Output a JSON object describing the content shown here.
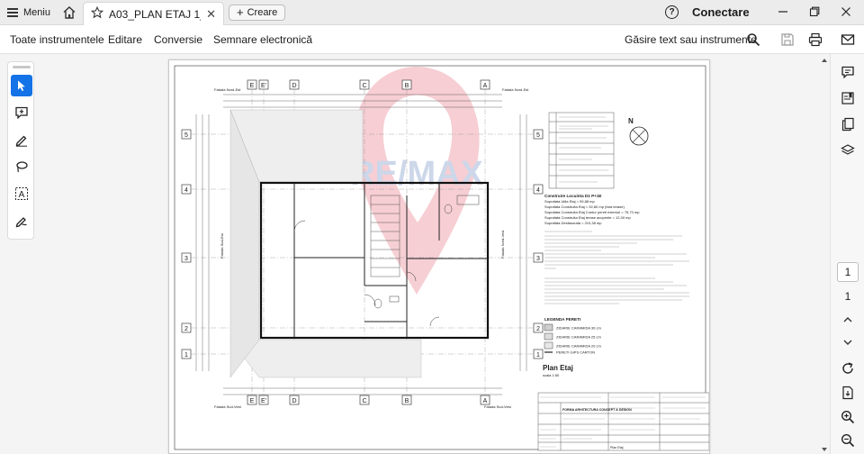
{
  "app": {
    "menu_label": "Meniu",
    "tab_title": "A03_PLAN ETAJ 1_...",
    "create_label": "Creare",
    "sign_in_label": "Conectare",
    "help_symbol": "?",
    "icons": [
      "hamburger-icon",
      "home-icon",
      "star-icon",
      "close-icon",
      "plus-icon",
      "help-icon",
      "minimize-icon",
      "restore-icon",
      "close-window-icon"
    ]
  },
  "toolbar": {
    "items": [
      "Toate instrumentele",
      "Editare",
      "Conversie",
      "Semnare electronică"
    ],
    "find_label": "Găsire text sau instrumente"
  },
  "left_tools": [
    "select-tool-icon",
    "comment-icon",
    "draw-icon",
    "lasso-icon",
    "text-select-icon",
    "sign-icon"
  ],
  "right_tools": [
    "comments-icon",
    "bookmarks-icon",
    "pages-icon",
    "layers-icon"
  ],
  "navigation": {
    "current_page": "1",
    "total_pages": "1"
  },
  "document": {
    "watermark": "RE/MAX",
    "plan_title": "Plan Etaj",
    "plan_scale": "scala 1:50",
    "north": "N",
    "legend_title": "LEGENDA PERETI",
    "legend_items": [
      "ZIDARIE CARAMIDA 30 cm",
      "ZIDARIE CARAMIDA 25 cm",
      "ZIDARIE CARAMIDA 20 cm",
      "PERETI GIPS CARTON"
    ],
    "area_title": "Construire Locuinta D1 P+1E",
    "area_lines": [
      "Suprafata Utila Etaj = 99,88 mp",
      "Suprafata Construita Etaj = 92,80 mp  (fara terase)",
      "Suprafata Construita Etaj Contur pereti exteriori = 75,70 mp",
      "Suprafata Construita Etaj terase acoperite = 12,00 mp",
      "Suprafata Desfasurata = 210,38 mp"
    ],
    "axes_top": [
      "E",
      "E'",
      "D",
      "C",
      "B",
      "A"
    ],
    "axes_side": [
      "5",
      "4",
      "3",
      "2",
      "1"
    ],
    "facade_labels": [
      "Fatada Nord-Est",
      "Fatada Nord-Est",
      "Fatada Sud-Vest",
      "Fatada Sud-Vest",
      "Fatada Sud-Est",
      "Fatada Nord-Vest"
    ],
    "title_block_firm": "FORMA ARHITECTURA CONCEPT & DESIGN",
    "title_block_drawing": "Plan Etaj"
  }
}
